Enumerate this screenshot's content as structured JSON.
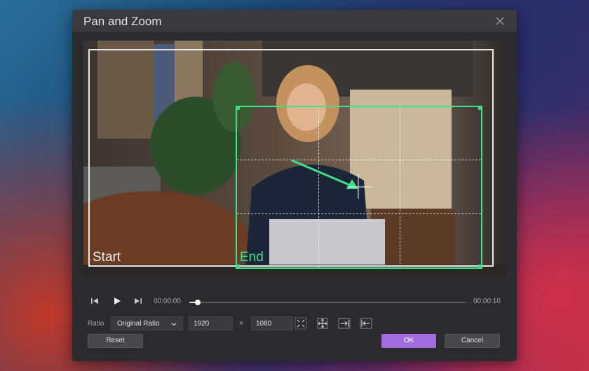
{
  "dialog": {
    "title": "Pan and Zoom",
    "close_icon": "close-icon"
  },
  "preview": {
    "start_label": "Start",
    "end_label": "End",
    "colors": {
      "start_frame": "#e8e8e8",
      "end_frame": "#3ee08a"
    }
  },
  "playback": {
    "current_time": "00:00:00",
    "total_time": "00:00:10",
    "progress": 0.03,
    "icons": [
      "skip-back-icon",
      "play-icon",
      "skip-forward-icon"
    ]
  },
  "ratio": {
    "label": "Ratio",
    "selected": "Original Ratio",
    "width_value": "1920",
    "height_value": "1080",
    "separator": "×",
    "tool_icons": [
      "fit-inward-icon",
      "move-center-icon",
      "align-right-icon",
      "align-left-icon"
    ]
  },
  "buttons": {
    "reset": "Reset",
    "ok": "OK",
    "cancel": "Cancel"
  },
  "colors": {
    "accent": "#a36de0",
    "end_frame": "#3ee08a"
  }
}
